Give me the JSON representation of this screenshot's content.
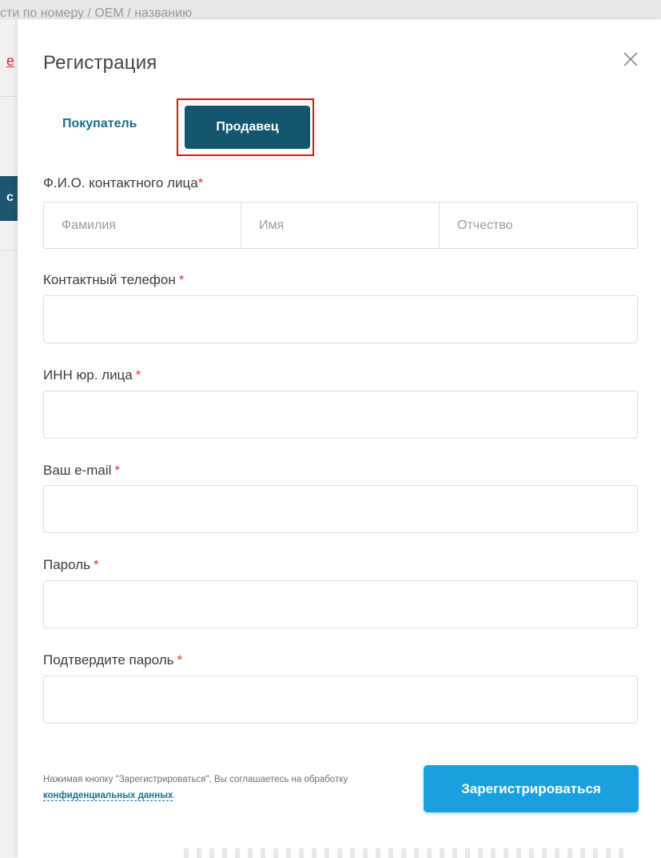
{
  "background": {
    "search_hint": "сти по номеру / OEM / названию",
    "link_fragment": "е",
    "button_fragment": "с"
  },
  "modal": {
    "title": "Регистрация",
    "close_icon": "close-icon"
  },
  "tabs": {
    "buyer": "Покупатель",
    "seller": "Продавец",
    "active": "seller"
  },
  "form": {
    "fio": {
      "label": "Ф.И.О. контактного лица",
      "required": "*",
      "last_name_placeholder": "Фамилия",
      "first_name_placeholder": "Имя",
      "middle_name_placeholder": "Отчество"
    },
    "phone": {
      "label": "Контактный телефон",
      "required": "*",
      "value": ""
    },
    "inn": {
      "label": "ИНН юр. лица",
      "required": "*",
      "value": ""
    },
    "email": {
      "label": "Ваш e-mail",
      "required": "*",
      "value": ""
    },
    "password": {
      "label": "Пароль",
      "required": "*",
      "value": ""
    },
    "password_confirm": {
      "label": "Подтвердите пароль",
      "required": "*",
      "value": ""
    }
  },
  "consent": {
    "text_before": "Нажимая кнопку \"Зарегистрироваться\", Вы соглашаетесь на обработку ",
    "link": "конфиденциальных данных",
    "text_after": "."
  },
  "submit": {
    "label": "Зарегистрироваться"
  },
  "colors": {
    "accent_dark": "#15566f",
    "accent_link": "#1b6f8a",
    "primary_button": "#1a9fe0",
    "required_mark": "#e0382c",
    "highlight_border": "#c81e1e"
  }
}
